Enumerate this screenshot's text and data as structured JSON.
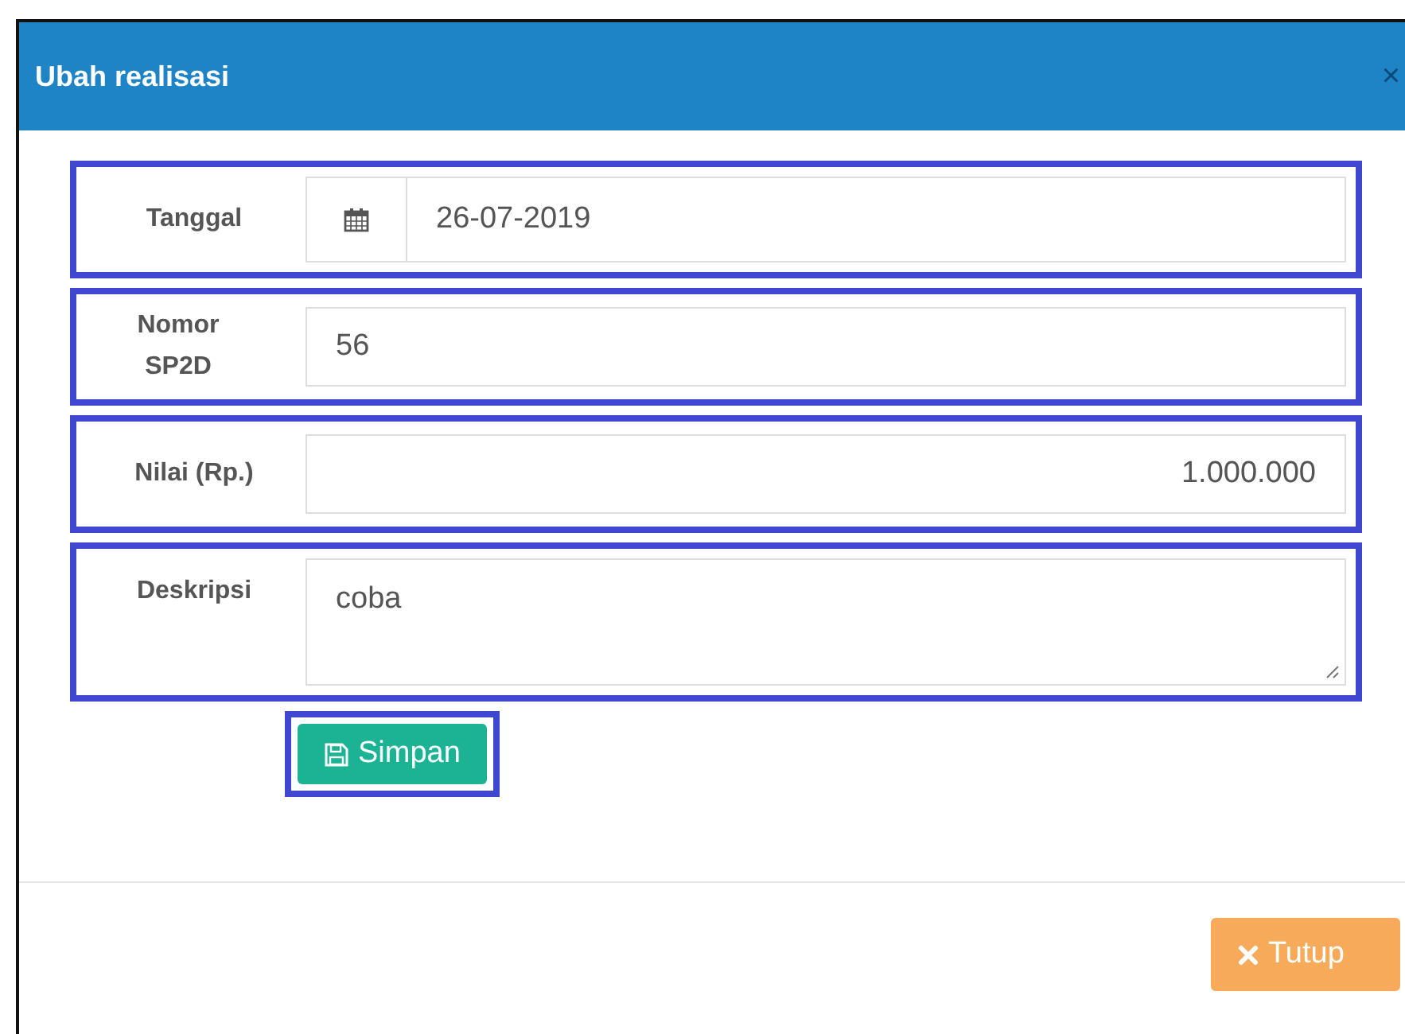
{
  "dialog": {
    "title": "Ubah realisasi",
    "close": "×"
  },
  "fields": [
    {
      "kind": "date",
      "label": "Tanggal",
      "value": "26-07-2019",
      "highlighted": true
    },
    {
      "kind": "text",
      "label": "Nomor SP2D",
      "value": "56",
      "highlighted": true
    },
    {
      "kind": "number",
      "label": "Nilai (Rp.)",
      "value": "1.000.000",
      "highlighted": true
    },
    {
      "kind": "textarea",
      "label": "Deskripsi",
      "value": "coba",
      "highlighted": true
    }
  ],
  "save_button": {
    "label": "Simpan",
    "highlighted": true
  },
  "close_button": {
    "label": "Tutup"
  }
}
